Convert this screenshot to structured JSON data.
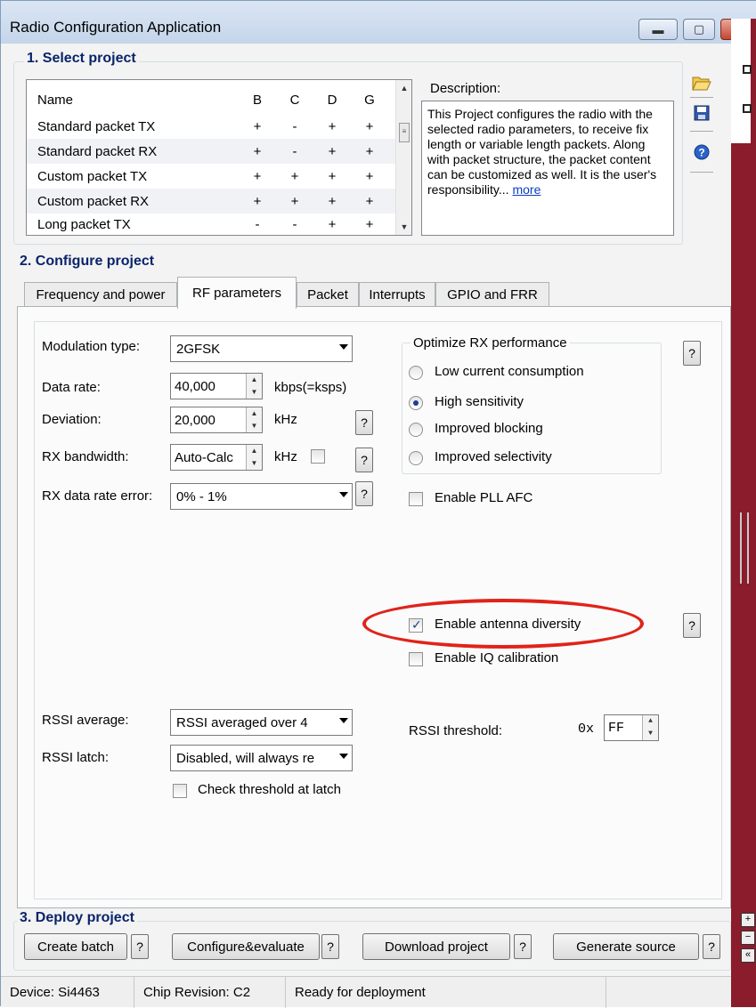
{
  "window": {
    "title": "Radio Configuration Application",
    "controls": [
      "minimize",
      "maximize",
      "close"
    ]
  },
  "select_project": {
    "label": "1. Select project",
    "columns": [
      "Name",
      "B",
      "C",
      "D",
      "G"
    ],
    "rows": [
      {
        "name": "Standard packet TX",
        "b": "+",
        "c": "-",
        "d": "+",
        "g": "+"
      },
      {
        "name": "Standard packet RX",
        "b": "+",
        "c": "-",
        "d": "+",
        "g": "+"
      },
      {
        "name": "Custom packet TX",
        "b": "+",
        "c": "+",
        "d": "+",
        "g": "+"
      },
      {
        "name": "Custom packet RX",
        "b": "+",
        "c": "+",
        "d": "+",
        "g": "+"
      },
      {
        "name": "Long packet TX",
        "b": "-",
        "c": "-",
        "d": "+",
        "g": "+"
      }
    ],
    "description_label": "Description:",
    "description_text": "This Project configures the radio with the selected radio parameters, to receive fix length or variable length packets. Along with packet structure, the packet content can be customized as well. It is the user's responsibility...",
    "description_link": "more"
  },
  "side_icons": [
    "folder-open-icon",
    "save-icon",
    "help-icon"
  ],
  "configure_project": {
    "label": "2. Configure project",
    "tabs": [
      "Frequency and power",
      "RF parameters",
      "Packet",
      "Interrupts",
      "GPIO and FRR"
    ],
    "active_tab": "RF parameters"
  },
  "rf": {
    "modulation_label": "Modulation type:",
    "modulation_value": "2GFSK",
    "data_rate_label": "Data rate:",
    "data_rate_value": "40,000",
    "data_rate_unit": "kbps(=ksps)",
    "deviation_label": "Deviation:",
    "deviation_value": "20,000",
    "deviation_unit": "kHz",
    "rx_bw_label": "RX bandwidth:",
    "rx_bw_value": "Auto-Calc",
    "rx_bw_unit": "kHz",
    "rx_error_label": "RX data rate error:",
    "rx_error_value": "0% - 1%",
    "optimize_label": "Optimize RX performance",
    "optimize_options": [
      "Low current consumption",
      "High sensitivity",
      "Improved blocking",
      "Improved selectivity"
    ],
    "optimize_selected": "High sensitivity",
    "pll_afc_label": "Enable PLL AFC",
    "antenna_diversity_label": "Enable antenna diversity",
    "antenna_diversity_checked": true,
    "iq_cal_label": "Enable IQ calibration",
    "rssi_avg_label": "RSSI average:",
    "rssi_avg_value": "RSSI averaged over 4",
    "rssi_latch_label": "RSSI latch:",
    "rssi_latch_value": "Disabled, will always re",
    "check_threshold_label": "Check threshold at latch",
    "rssi_threshold_label": "RSSI threshold:",
    "rssi_threshold_prefix": "0x",
    "rssi_threshold_value": "FF",
    "help": "?"
  },
  "deploy": {
    "label": "3. Deploy project",
    "buttons": [
      "Create batch",
      "Configure&evaluate",
      "Download project",
      "Generate source"
    ]
  },
  "status": {
    "device": "Device: Si4463",
    "chip": "Chip Revision: C2",
    "state": "Ready for deployment"
  },
  "colors": {
    "highlight_ellipse": "#e0231a",
    "accent": "#0a246a",
    "side_strip": "#8b1c2c"
  }
}
